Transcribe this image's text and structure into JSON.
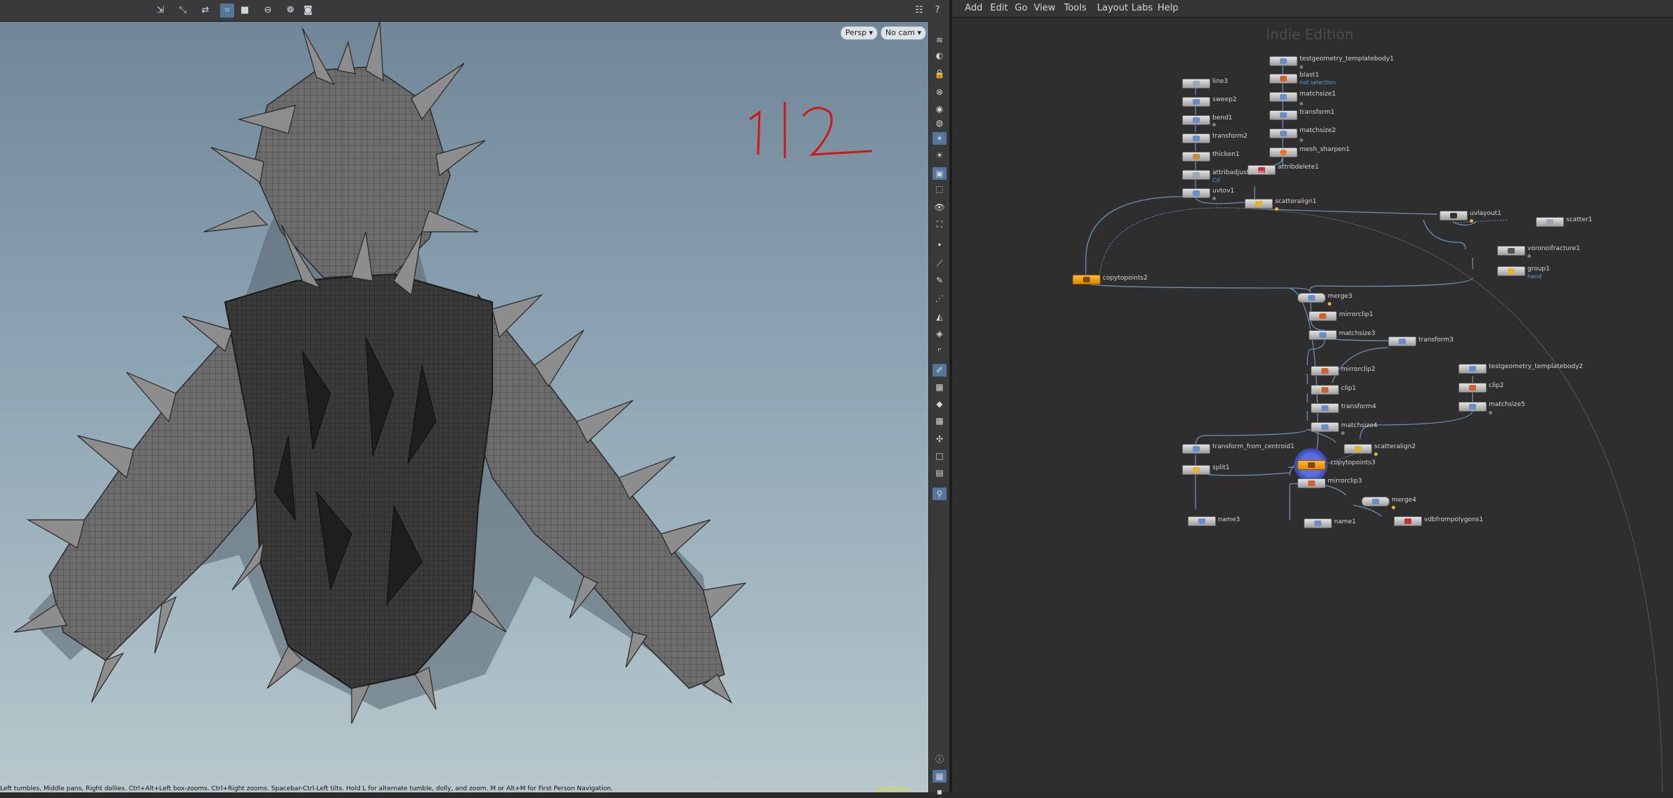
{
  "viewport": {
    "persp_label": "Persp",
    "cam_label": "No cam",
    "annotation": "1/2",
    "status_text": "Left tumbles, Middle pans, Right dollies. Ctrl+Alt+Left box-zooms. Ctrl+Right zooms. Spacebar-Ctrl-Left tilts. Hold L for alternate tumble, dolly, and zoom. M or Alt+M for First Person Navigation.",
    "indie_tag": "Indie Edition",
    "toolbar_icons": [
      "select-icon",
      "transform-icon",
      "handle-icon",
      "snap-icon",
      "display-icon",
      "no-entry-icon",
      "camera-icon",
      "render-icon",
      "grid-menu-icon",
      "help-icon"
    ]
  },
  "menubar": {
    "items": [
      "Add",
      "Edit",
      "Go",
      "View",
      "Tools",
      "Layout",
      "Labs",
      "Help"
    ]
  },
  "network": {
    "watermark": "Indie Edition",
    "nodes": [
      {
        "name": "testgeometry_templatebody1",
        "sub": ""
      },
      {
        "name": "blast1",
        "sub": "not selection"
      },
      {
        "name": "matchsize1",
        "sub": ""
      },
      {
        "name": "transform1",
        "sub": ""
      },
      {
        "name": "matchsize2",
        "sub": ""
      },
      {
        "name": "mesh_sharpen1",
        "sub": ""
      },
      {
        "name": "attribdelete1",
        "sub": ""
      },
      {
        "name": "line3",
        "sub": ""
      },
      {
        "name": "sweep2",
        "sub": ""
      },
      {
        "name": "bend1",
        "sub": ""
      },
      {
        "name": "transform2",
        "sub": ""
      },
      {
        "name": "thicken1",
        "sub": ""
      },
      {
        "name": "attribadjustcolor1",
        "sub": "Cd"
      },
      {
        "name": "uvtov1",
        "sub": ""
      },
      {
        "name": "scatteralign1",
        "sub": ""
      },
      {
        "name": "uvlayout1",
        "sub": ""
      },
      {
        "name": "scatter1",
        "sub": ""
      },
      {
        "name": "voronoifracture1",
        "sub": ""
      },
      {
        "name": "group1",
        "sub": "hand"
      },
      {
        "name": "copytopoints2",
        "sub": ""
      },
      {
        "name": "merge3",
        "sub": ""
      },
      {
        "name": "mirrorclip1",
        "sub": ""
      },
      {
        "name": "matchsize3",
        "sub": ""
      },
      {
        "name": "transform3",
        "sub": ""
      },
      {
        "name": "mirrorclip2",
        "sub": ""
      },
      {
        "name": "clip1",
        "sub": ""
      },
      {
        "name": "transform4",
        "sub": ""
      },
      {
        "name": "matchsize4",
        "sub": ""
      },
      {
        "name": "testgeometry_templatebody2",
        "sub": ""
      },
      {
        "name": "clip2",
        "sub": ""
      },
      {
        "name": "matchsize5",
        "sub": ""
      },
      {
        "name": "transform_from_centroid1",
        "sub": ""
      },
      {
        "name": "scatteralign2",
        "sub": ""
      },
      {
        "name": "copytopoints3",
        "sub": ""
      },
      {
        "name": "split1",
        "sub": ""
      },
      {
        "name": "mirrorclip3",
        "sub": ""
      },
      {
        "name": "merge4",
        "sub": ""
      },
      {
        "name": "name3",
        "sub": ""
      },
      {
        "name": "name1",
        "sub": ""
      },
      {
        "name": "vdbfrompolygons1",
        "sub": ""
      }
    ]
  }
}
